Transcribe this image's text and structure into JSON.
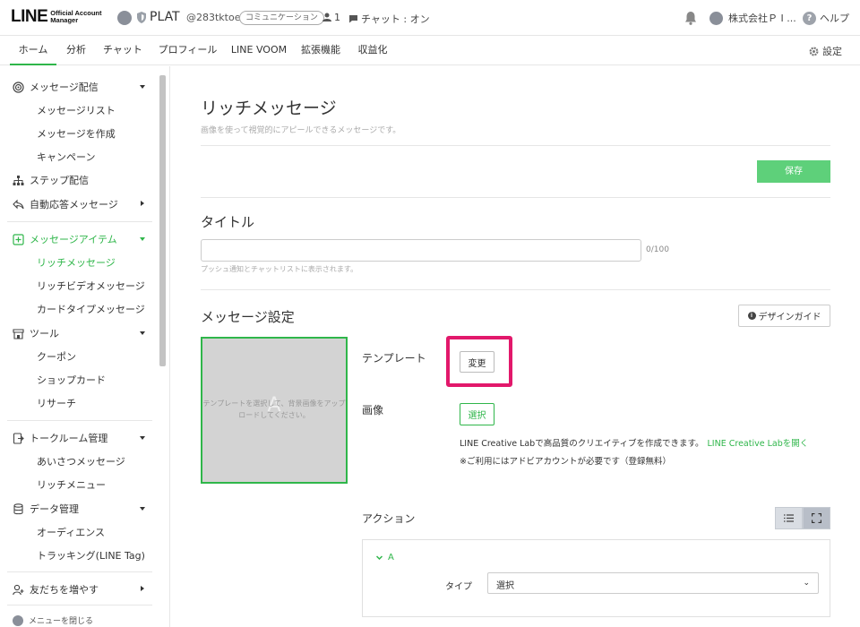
{
  "header": {
    "logo_main": "LINE",
    "logo_sub_1": "Official Account",
    "logo_sub_2": "Manager",
    "account_name": "PLAT",
    "account_id": "@283tktoe",
    "account_tag": "コミュニケーション",
    "friends_count": "1",
    "chat_status": "チャット : オン",
    "company": "株式会社Ｐ I ...",
    "help": "ヘルプ"
  },
  "tabs": [
    {
      "label": "ホーム",
      "active": true
    },
    {
      "label": "分析"
    },
    {
      "label": "チャット"
    },
    {
      "label": "プロフィール"
    },
    {
      "label": "LINE VOOM"
    },
    {
      "label": "拡張機能"
    },
    {
      "label": "収益化"
    }
  ],
  "settings_label": "設定",
  "sidebar": {
    "groups": {
      "message_delivery": "メッセージ配信",
      "message_list": "メッセージリスト",
      "create_message": "メッセージを作成",
      "campaign": "キャンペーン",
      "step_delivery": "ステップ配信",
      "auto_reply": "自動応答メッセージ",
      "message_items": "メッセージアイテム",
      "rich_message": "リッチメッセージ",
      "rich_video": "リッチビデオメッセージ",
      "card_type": "カードタイプメッセージ",
      "tools": "ツール",
      "coupon": "クーポン",
      "shop_card": "ショップカード",
      "research": "リサーチ",
      "chatroom": "トークルーム管理",
      "greeting": "あいさつメッセージ",
      "rich_menu": "リッチメニュー",
      "data": "データ管理",
      "audience": "オーディエンス",
      "tracking": "トラッキング(LINE Tag)",
      "add_friends": "友だちを増やす",
      "close_menu": "メニューを閉じる"
    }
  },
  "main": {
    "title": "リッチメッセージ",
    "description": "画像を使って視覚的にアピールできるメッセージです。",
    "save": "保存",
    "title_section": "タイトル",
    "title_value": "",
    "title_count": "0/100",
    "title_help": "プッシュ通知とチャットリストに表示されます。",
    "message_settings": "メッセージ設定",
    "design_guide": "デザインガイド",
    "preview_letter": "A",
    "preview_text": "テンプレートを選択して、背景画像をアップロードしてください。",
    "template_label": "テンプレート",
    "change_button": "変更",
    "image_label": "画像",
    "select_button": "選択",
    "creative_text": "LINE Creative Labで高品質のクリエイティブを作成できます。",
    "creative_link": "LINE Creative Labを開く",
    "note": "※ご利用にはアドビアカウントが必要です（登録無料）",
    "action_label": "アクション",
    "action_item": "A",
    "type_label": "タイプ",
    "type_value": "選択"
  },
  "colors": {
    "brand_green": "#2fb64a",
    "highlight": "#e2186b",
    "save_green": "#5ed07a"
  }
}
